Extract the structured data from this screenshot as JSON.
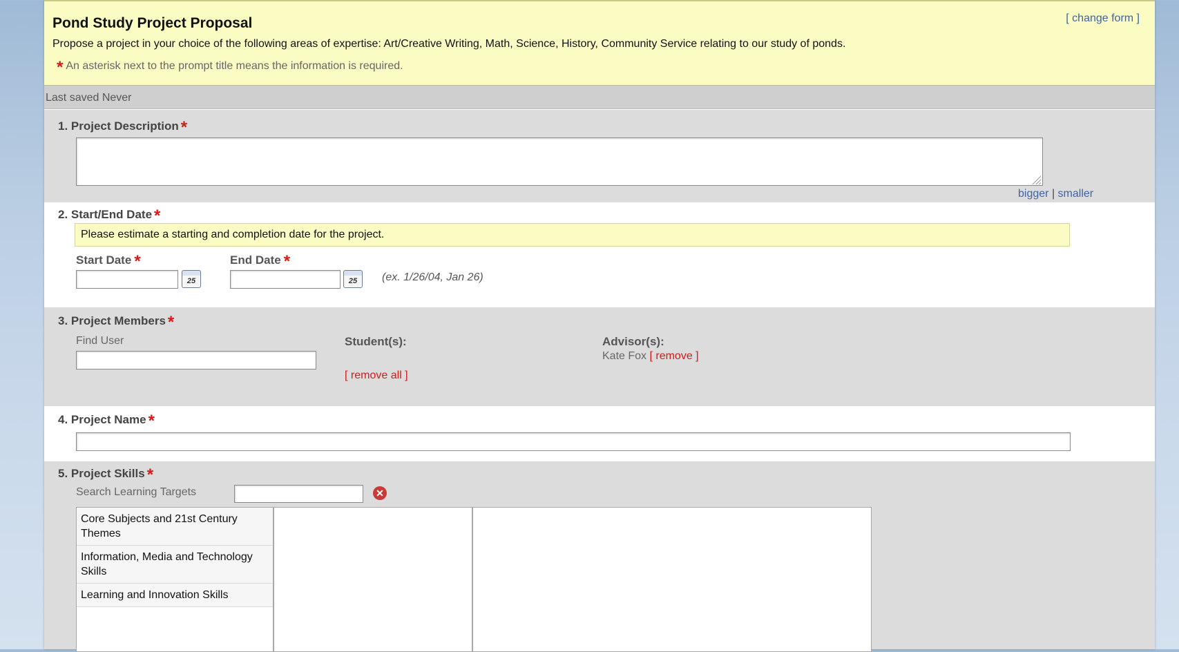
{
  "form": {
    "title": "Pond Study Project Proposal",
    "change_form": "[ change form ]",
    "description": "Propose a project in your choice of the following areas of expertise: Art/Creative Writing, Math, Science, History, Community Service relating to our study of ponds.",
    "required_star": "*",
    "required_note": "An asterisk next to the prompt title means the information is required."
  },
  "status": {
    "last_saved": "Last saved  Never"
  },
  "q1": {
    "label": "1. Project Description",
    "value": "",
    "bigger": "bigger",
    "separator": "|",
    "smaller": "smaller"
  },
  "q2": {
    "label": "2. Start/End Date",
    "hint": "Please estimate a starting and completion date for the project.",
    "start_label": "Start Date",
    "end_label": "End Date",
    "start_value": "",
    "end_value": "",
    "calendar_day": "25",
    "example": "(ex. 1/26/04, Jan 26)"
  },
  "q3": {
    "label": "3. Project Members",
    "find_user_label": "Find User",
    "find_user_value": "",
    "students_label": "Student(s):",
    "remove_all": "[ remove all ]",
    "advisors_label": "Advisor(s):",
    "advisor_name": "Kate Fox",
    "advisor_remove": "[ remove ]"
  },
  "q4": {
    "label": "4. Project Name",
    "value": ""
  },
  "q5": {
    "label": "5. Project Skills",
    "search_label": "Search Learning Targets",
    "search_value": "",
    "clear_glyph": "✕",
    "targets": [
      "Core Subjects and 21st Century Themes",
      "Information, Media and Technology Skills",
      "Learning and Innovation Skills"
    ]
  },
  "colors": {
    "accent_link": "#3d63a8",
    "required": "#d41a1a",
    "header_bg": "#fbfbc4"
  }
}
